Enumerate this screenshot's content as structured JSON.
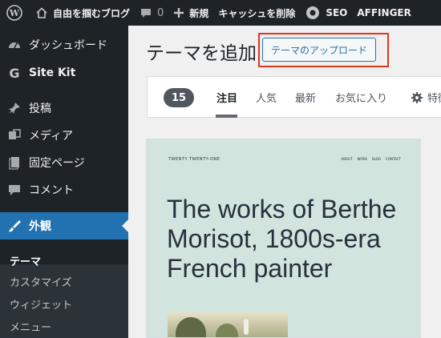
{
  "adminbar": {
    "site_name": "自由を掴むブログ",
    "comments_count": "0",
    "new_label": "新規",
    "cache_label": "キャッシュを削除",
    "seo_label": "SEO",
    "affinger_label": "AFFINGER"
  },
  "sidebar": {
    "items": [
      {
        "label": "ダッシュボード",
        "icon": "dashboard-icon"
      },
      {
        "label": "Site Kit",
        "icon": "google-g-icon"
      },
      {
        "label": "投稿",
        "icon": "pin-icon"
      },
      {
        "label": "メディア",
        "icon": "media-icon"
      },
      {
        "label": "固定ページ",
        "icon": "page-icon"
      },
      {
        "label": "コメント",
        "icon": "comment-icon"
      },
      {
        "label": "外観",
        "icon": "brush-icon"
      }
    ],
    "submenu": [
      "テーマ",
      "カスタマイズ",
      "ウィジェット",
      "メニュー"
    ]
  },
  "main": {
    "title": "テーマを追加",
    "upload_button": "テーマのアップロード",
    "count": "15",
    "tabs": [
      "注目",
      "人気",
      "最新",
      "お気に入り",
      "特徴"
    ]
  },
  "theme_preview": {
    "site_title": "TWENTY TWENTY-ONE",
    "nav": [
      "ABOUT",
      "WORK",
      "BLOG",
      "CONTACT"
    ],
    "heading": "The works of Berthe Morisot, 1800s-era French painter"
  },
  "colors": {
    "adminbar_bg": "#1d2327",
    "accent": "#2271b1",
    "highlight": "#e0361c",
    "theme_bg": "#d1e4dd"
  }
}
